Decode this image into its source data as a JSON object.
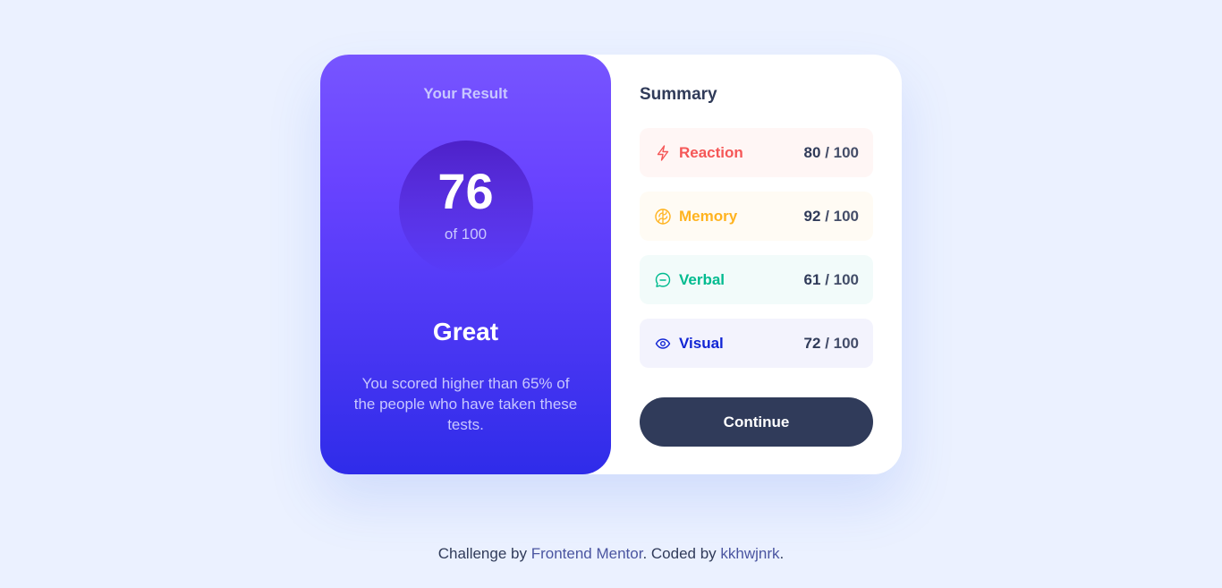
{
  "result": {
    "title": "Your Result",
    "score": "76",
    "score_of": "of 100",
    "verdict": "Great",
    "description": "You scored higher than 65% of the people who have taken these tests."
  },
  "summary": {
    "title": "Summary",
    "items": [
      {
        "label": "Reaction",
        "score": "80",
        "max": "/ 100",
        "icon": "lightning-icon",
        "color": "#f55757",
        "bg": "#fff6f5"
      },
      {
        "label": "Memory",
        "score": "92",
        "max": "/ 100",
        "icon": "brain-icon",
        "color": "#ffb31f",
        "bg": "#fffbf4"
      },
      {
        "label": "Verbal",
        "score": "61",
        "max": "/ 100",
        "icon": "speech-bubble-icon",
        "color": "#00bb8f",
        "bg": "#f2fbfa"
      },
      {
        "label": "Visual",
        "score": "72",
        "max": "/ 100",
        "icon": "eye-icon",
        "color": "#1125d4",
        "bg": "#f3f3fd"
      }
    ],
    "continue_label": "Continue"
  },
  "footer": {
    "prefix": "Challenge by ",
    "link1": "Frontend Mentor",
    "middle": ". Coded by ",
    "link2": "kkhwjnrk",
    "suffix": "."
  },
  "colors": {
    "background": "#ebf1ff",
    "gradient_start": "#7755ff",
    "gradient_end": "#2f2ce9",
    "button": "#303b5a"
  }
}
